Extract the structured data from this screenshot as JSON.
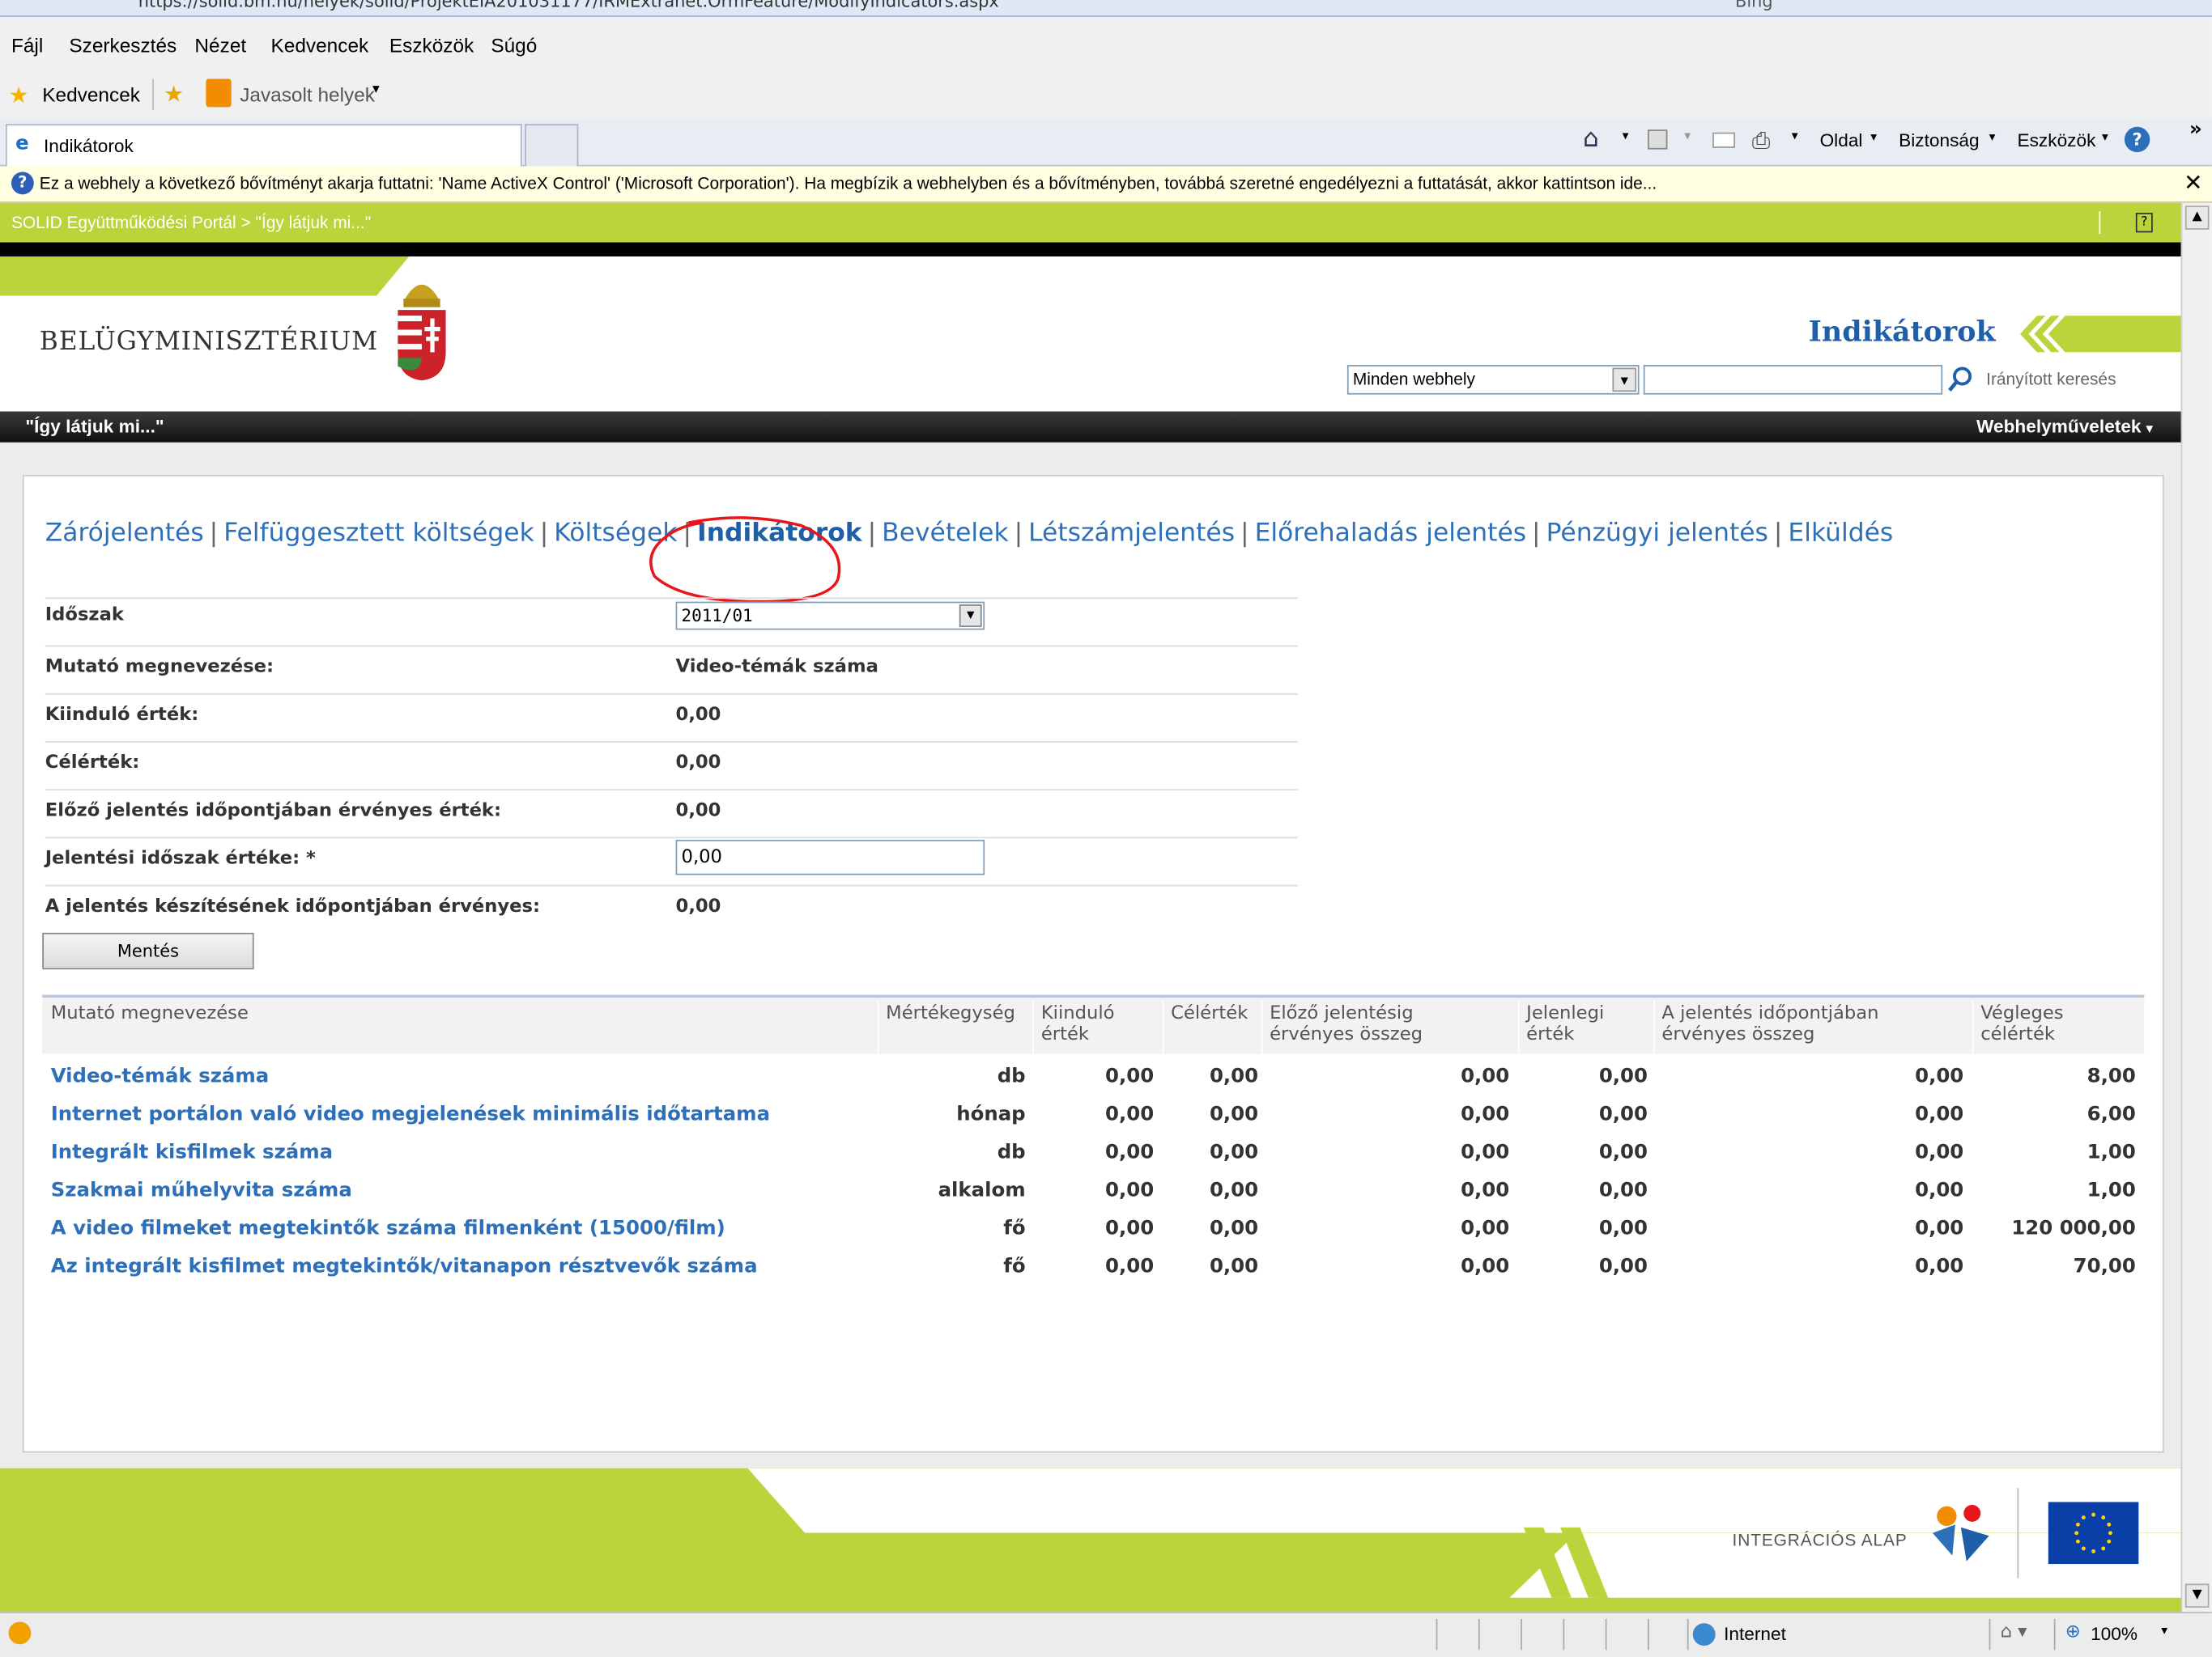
{
  "browser": {
    "url": "https://solid.bm.hu/helyek/solid/ProjektEIA201031177/IRMExtranet.OrmFeature/ModifyIndicators.aspx",
    "search_provider": "Bing",
    "menu": [
      "Fájl",
      "Szerkesztés",
      "Nézet",
      "Kedvencek",
      "Eszközök",
      "Súgó"
    ],
    "favorites_label": "Kedvencek",
    "suggested_sites": "Javasolt helyek",
    "tab_title": "Indikátorok",
    "commands": [
      "Oldal",
      "Biztonság",
      "Eszközök"
    ],
    "infobar_text": "Ez a webhely a következő bővítményt akarja futtatni: 'Name ActiveX Control' ('Microsoft Corporation'). Ha megbízik a webhelyben és a bővítményben, továbbá szeretné engedélyezni a futtatását, akkor kattintson ide...",
    "status_zone": "Internet",
    "zoom": "100%"
  },
  "site": {
    "breadcrumb": "SOLID Együttműködési Portál > \"Így látjuk mi...\"",
    "logo_text": "BELÜGYMINISZTÉRIUM",
    "title": "Indikátorok",
    "search_scope": "Minden webhely",
    "search_placeholder": "",
    "advanced_search": "Irányított keresés",
    "site_name": "\"Így látjuk mi...\"",
    "site_actions": "Webhelyműveletek"
  },
  "nav": {
    "links": [
      "Zárójelentés",
      "Felfüggesztett költségek",
      "Költségek",
      "Indikátorok",
      "Bevételek",
      "Létszámjelentés",
      "Előrehaladás jelentés",
      "Pénzügyi jelentés",
      "Elküldés"
    ],
    "current": "Indikátorok"
  },
  "form": {
    "period_label": "Időszak",
    "period_value": "2011/01",
    "indicator_name_label": "Mutató megnevezése:",
    "indicator_name_value": "Video-témák száma",
    "baseline_label": "Kiinduló érték:",
    "baseline_value": "0,00",
    "target_label": "Célérték:",
    "target_value": "0,00",
    "previous_label": "Előző jelentés időpontjában érvényes érték:",
    "previous_value": "0,00",
    "report_period_label": "Jelentési időszak értéke: *",
    "report_period_value": "0,00",
    "valid_label": "A jelentés készítésének időpontjában érvényes:",
    "valid_value": "0,00",
    "save_label": "Mentés"
  },
  "table": {
    "headers": {
      "name": "Mutató megnevezése",
      "unit": "Mértékegység",
      "baseline": "Kiinduló érték",
      "target": "Célérték",
      "prev_sum": "Előző jelentésig érvényes összeg",
      "current": "Jelenlegi érték",
      "report_sum": "A jelentés időpontjában érvényes összeg",
      "final_target": "Végleges célérték"
    },
    "rows": [
      {
        "name": "Video-témák száma",
        "unit": "db",
        "baseline": "0,00",
        "target": "0,00",
        "prev_sum": "0,00",
        "current": "0,00",
        "report_sum": "0,00",
        "final_target": "8,00"
      },
      {
        "name": "Internet portálon való video megjelenések minimális időtartama",
        "unit": "hónap",
        "baseline": "0,00",
        "target": "0,00",
        "prev_sum": "0,00",
        "current": "0,00",
        "report_sum": "0,00",
        "final_target": "6,00"
      },
      {
        "name": "Integrált kisfilmek száma",
        "unit": "db",
        "baseline": "0,00",
        "target": "0,00",
        "prev_sum": "0,00",
        "current": "0,00",
        "report_sum": "0,00",
        "final_target": "1,00"
      },
      {
        "name": "Szakmai műhelyvita száma",
        "unit": "alkalom",
        "baseline": "0,00",
        "target": "0,00",
        "prev_sum": "0,00",
        "current": "0,00",
        "report_sum": "0,00",
        "final_target": "1,00"
      },
      {
        "name": "A video filmeket megtekintők száma filmenként (15000/film)",
        "unit": "fő",
        "baseline": "0,00",
        "target": "0,00",
        "prev_sum": "0,00",
        "current": "0,00",
        "report_sum": "0,00",
        "final_target": "120 000,00"
      },
      {
        "name": "Az integrált kisfilmet megtekintők/vitanapon résztvevők száma",
        "unit": "fő",
        "baseline": "0,00",
        "target": "0,00",
        "prev_sum": "0,00",
        "current": "0,00",
        "report_sum": "0,00",
        "final_target": "70,00"
      }
    ]
  },
  "footer": {
    "fund_label": "INTEGRÁCIÓS ALAP"
  },
  "colors": {
    "lime": "#bcd43c",
    "link": "#2d6fb8",
    "annotation": "#e8161b"
  }
}
